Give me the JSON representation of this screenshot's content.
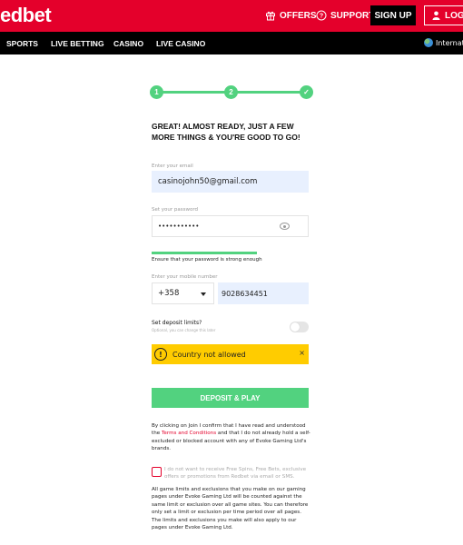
{
  "header": {
    "logo": "edbet",
    "offers_label": "OFFERS",
    "support_label": "SUPPORT",
    "signup_label": "SIGN UP",
    "login_label": "LOG IN"
  },
  "nav": {
    "items": [
      "SPORTS",
      "LIVE BETTING",
      "CASINO",
      "LIVE CASINO"
    ],
    "region_label": "International"
  },
  "stepper": {
    "steps": [
      "1",
      "2",
      "✓"
    ],
    "current": 3,
    "color": "#52d27f"
  },
  "form": {
    "heading": "GREAT! ALMOST READY, JUST A FEW MORE THINGS & YOU'RE GOOD TO GO!",
    "email_label": "Enter your email",
    "email_value": "casinojohn50@gmail.com",
    "password_label": "Set your password",
    "password_value": "•••••••••••",
    "password_strength_hint": "Ensure that your password is strong enough",
    "password_strength": 0.67,
    "mobile_label": "Enter your mobile number",
    "country_code": "+358",
    "mobile_value": "9028634451",
    "deposit_title": "Set deposit limits?",
    "deposit_subtitle": "Optional, you can change this later",
    "deposit_toggle_on": false,
    "alert_message": "Country not allowed",
    "alert_close": "×",
    "alert_icon": "!",
    "cta_label": "DEPOSIT & PLAY",
    "terms_before": "By clicking on Join I confirm that I have read and understood the ",
    "terms_link": "Terms and Conditions",
    "terms_after": " and that I do not already hold a self-excluded or blocked account with any of Evoke Gaming Ltd's brands.",
    "optout_label": "I do not want to receive Free Spins, Free Bets, exclusive offers or promotions from Redbet via email or SMS.",
    "optout_checked": false,
    "limits_text": "All game limits and exclusions that you make on our gaming pages under Evoke Gaming Ltd will be counted against the same limit or exclusion over all game sites. You can therefore only set a limit or exclusion per time period over all pages. The limits and exclusions you make will also apply to our pages under Evoke Gaming Ltd."
  },
  "colors": {
    "brand_red": "#e4002b",
    "success_green": "#52d27f",
    "alert_yellow": "#ffcc00"
  }
}
